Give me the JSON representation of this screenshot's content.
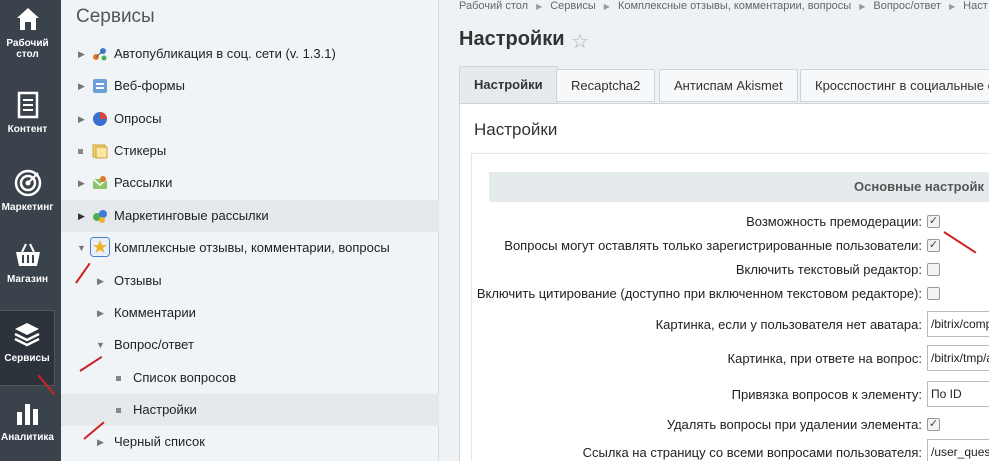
{
  "rail": {
    "items": [
      {
        "label": "Рабочий стол",
        "icon": "home-icon"
      },
      {
        "label": "Контент",
        "icon": "document-icon"
      },
      {
        "label": "Маркетинг",
        "icon": "target-icon"
      },
      {
        "label": "Магазин",
        "icon": "basket-icon"
      },
      {
        "label": "Сервисы",
        "icon": "layers-icon",
        "active": true
      },
      {
        "label": "Аналитика",
        "icon": "bar-chart-icon"
      }
    ]
  },
  "tree": {
    "title": "Сервисы",
    "items": [
      {
        "label": "Автопубликация в соц. сети (v. 1.3.1)",
        "icon": "network-icon"
      },
      {
        "label": "Веб-формы",
        "icon": "form-icon"
      },
      {
        "label": "Опросы",
        "icon": "pie-icon"
      },
      {
        "label": "Стикеры",
        "icon": "sticker-icon"
      },
      {
        "label": "Рассылки",
        "icon": "mail-icon"
      },
      {
        "label": "Маркетинговые рассылки",
        "icon": "marketing-mail-icon"
      },
      {
        "label": "Комплексные отзывы, комментарии, вопросы",
        "icon": "star-icon"
      },
      {
        "label": "Отзывы"
      },
      {
        "label": "Комментарии"
      },
      {
        "label": "Вопрос/ответ"
      },
      {
        "label": "Список вопросов"
      },
      {
        "label": "Настройки"
      },
      {
        "label": "Черный список"
      }
    ]
  },
  "breadcrumb": [
    "Рабочий стол",
    "Сервисы",
    "Комплексные отзывы, комментарии, вопросы",
    "Вопрос/ответ",
    "Наст"
  ],
  "page_title": "Настройки",
  "tabs": [
    "Настройки",
    "Recaptcha2",
    "Антиспам Akismet",
    "Кросспостинг в социальные с"
  ],
  "panel_title": "Настройки",
  "section_title": "Основные настройк",
  "settings": [
    {
      "label": "Возможность премодерации:",
      "type": "checkbox",
      "checked": true
    },
    {
      "label": "Вопросы могут оставлять только зарегистрированные пользователи:",
      "type": "checkbox",
      "checked": true
    },
    {
      "label": "Включить текстовый редактор:",
      "type": "checkbox",
      "checked": false
    },
    {
      "label": "Включить цитирование (доступно при включенном текстовом редакторе):",
      "type": "checkbox",
      "checked": false
    },
    {
      "label": "Картинка, если у пользователя нет аватара:",
      "type": "input",
      "value": "/bitrix/comp"
    },
    {
      "label": "Картинка, при ответе на вопрос:",
      "type": "input",
      "value": "/bitrix/tmp/a"
    },
    {
      "label": "Привязка вопросов к элементу:",
      "type": "select",
      "value": "По ID"
    },
    {
      "label": "Удалять вопросы при удалении элемента:",
      "type": "checkbox",
      "checked": true
    },
    {
      "label": "Ссылка на страницу со всеми вопросами пользователя:",
      "type": "input",
      "value": "/user_ques"
    }
  ],
  "colors": {
    "rail_bg": "#3a424b",
    "annotation_red": "#cc2222"
  }
}
